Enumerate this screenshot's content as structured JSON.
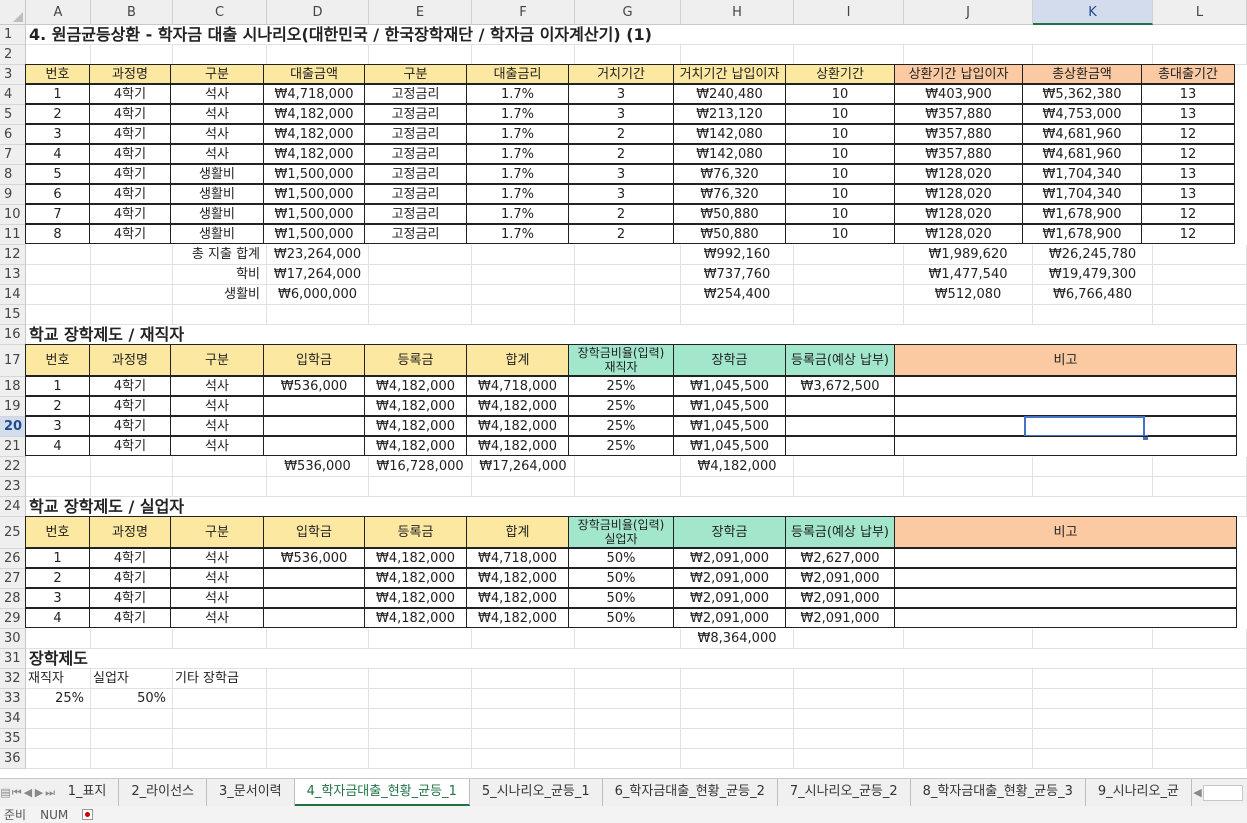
{
  "columns": [
    "A",
    "B",
    "C",
    "D",
    "E",
    "F",
    "G",
    "H",
    "I",
    "J",
    "K",
    "L"
  ],
  "selected_column": "K",
  "selected_row": "20",
  "rows": [
    "1",
    "2",
    "3",
    "4",
    "5",
    "6",
    "7",
    "8",
    "9",
    "10",
    "11",
    "12",
    "13",
    "14",
    "15",
    "16",
    "17",
    "18",
    "19",
    "20",
    "21",
    "22",
    "23",
    "24",
    "25",
    "26",
    "27",
    "28",
    "29",
    "30",
    "31",
    "32",
    "33",
    "34",
    "35",
    "36"
  ],
  "title": "4. 원금균등상환 - 학자금 대출 시나리오(대한민국 / 한국장학재단 / 학자금 이자계산기) (1)",
  "loan_table": {
    "headers": [
      "번호",
      "과정명",
      "구분",
      "대출금액",
      "구분",
      "대출금리",
      "거치기간",
      "거치기간 납입이자",
      "상환기간",
      "상환기간 납입이자",
      "총상환금액",
      "총대출기간"
    ],
    "rows": [
      [
        "1",
        "4학기",
        "석사",
        "₩4,718,000",
        "고정금리",
        "1.7%",
        "3",
        "₩240,480",
        "10",
        "₩403,900",
        "₩5,362,380",
        "13"
      ],
      [
        "2",
        "4학기",
        "석사",
        "₩4,182,000",
        "고정금리",
        "1.7%",
        "3",
        "₩213,120",
        "10",
        "₩357,880",
        "₩4,753,000",
        "13"
      ],
      [
        "3",
        "4학기",
        "석사",
        "₩4,182,000",
        "고정금리",
        "1.7%",
        "2",
        "₩142,080",
        "10",
        "₩357,880",
        "₩4,681,960",
        "12"
      ],
      [
        "4",
        "4학기",
        "석사",
        "₩4,182,000",
        "고정금리",
        "1.7%",
        "2",
        "₩142,080",
        "10",
        "₩357,880",
        "₩4,681,960",
        "12"
      ],
      [
        "5",
        "4학기",
        "생활비",
        "₩1,500,000",
        "고정금리",
        "1.7%",
        "3",
        "₩76,320",
        "10",
        "₩128,020",
        "₩1,704,340",
        "13"
      ],
      [
        "6",
        "4학기",
        "생활비",
        "₩1,500,000",
        "고정금리",
        "1.7%",
        "3",
        "₩76,320",
        "10",
        "₩128,020",
        "₩1,704,340",
        "13"
      ],
      [
        "7",
        "4학기",
        "생활비",
        "₩1,500,000",
        "고정금리",
        "1.7%",
        "2",
        "₩50,880",
        "10",
        "₩128,020",
        "₩1,678,900",
        "12"
      ],
      [
        "8",
        "4학기",
        "생활비",
        "₩1,500,000",
        "고정금리",
        "1.7%",
        "2",
        "₩50,880",
        "10",
        "₩128,020",
        "₩1,678,900",
        "12"
      ]
    ],
    "summary": [
      {
        "label": "총 지출 합계",
        "amount": "₩23,264,000",
        "h": "₩992,160",
        "j": "₩1,989,620",
        "k": "₩26,245,780"
      },
      {
        "label": "학비",
        "amount": "₩17,264,000",
        "h": "₩737,760",
        "j": "₩1,477,540",
        "k": "₩19,479,300"
      },
      {
        "label": "생활비",
        "amount": "₩6,000,000",
        "h": "₩254,400",
        "j": "₩512,080",
        "k": "₩6,766,480"
      }
    ]
  },
  "employed": {
    "title": "학교 장학제도 / 재직자",
    "headers": [
      "번호",
      "과정명",
      "구분",
      "입학금",
      "등록금",
      "합계",
      "장학금비율(입력)",
      "재직자",
      "장학금",
      "등록금(예상 납부)",
      "비고"
    ],
    "rows": [
      [
        "1",
        "4학기",
        "석사",
        "₩536,000",
        "₩4,182,000",
        "₩4,718,000",
        "25%",
        "₩1,045,500",
        "₩3,672,500",
        ""
      ],
      [
        "2",
        "4학기",
        "석사",
        "",
        "₩4,182,000",
        "₩4,182,000",
        "25%",
        "₩1,045,500",
        "",
        ""
      ],
      [
        "3",
        "4학기",
        "석사",
        "",
        "₩4,182,000",
        "₩4,182,000",
        "25%",
        "₩1,045,500",
        "",
        ""
      ],
      [
        "4",
        "4학기",
        "석사",
        "",
        "₩4,182,000",
        "₩4,182,000",
        "25%",
        "₩1,045,500",
        "",
        ""
      ]
    ],
    "totals": {
      "d": "₩536,000",
      "e": "₩16,728,000",
      "f": "₩17,264,000",
      "h": "₩4,182,000"
    }
  },
  "unemployed": {
    "title": "학교 장학제도 / 실업자",
    "headers": [
      "번호",
      "과정명",
      "구분",
      "입학금",
      "등록금",
      "합계",
      "장학금비율(입력)",
      "실업자",
      "장학금",
      "등록금(예상 납부)",
      "비고"
    ],
    "rows": [
      [
        "1",
        "4학기",
        "석사",
        "₩536,000",
        "₩4,182,000",
        "₩4,718,000",
        "50%",
        "₩2,091,000",
        "₩2,627,000",
        ""
      ],
      [
        "2",
        "4학기",
        "석사",
        "",
        "₩4,182,000",
        "₩4,182,000",
        "50%",
        "₩2,091,000",
        "₩2,091,000",
        ""
      ],
      [
        "3",
        "4학기",
        "석사",
        "",
        "₩4,182,000",
        "₩4,182,000",
        "50%",
        "₩2,091,000",
        "₩2,091,000",
        ""
      ],
      [
        "4",
        "4학기",
        "석사",
        "",
        "₩4,182,000",
        "₩4,182,000",
        "50%",
        "₩2,091,000",
        "₩2,091,000",
        ""
      ]
    ],
    "totals": {
      "h": "₩8,364,000"
    }
  },
  "scholarship": {
    "title": "장학제도",
    "labels": [
      "재직자",
      "실업자",
      "기타 장학금"
    ],
    "values": [
      "25%",
      "50%"
    ]
  },
  "tabs": [
    "1_표지",
    "2_라이선스",
    "3_문서이력",
    "4_학자금대출_현황_균등_1",
    "5_시나리오_균등_1",
    "6_학자금대출_현황_균등_2",
    "7_시나리오_균등_2",
    "8_학자금대출_현황_균등_3",
    "9_시나리오_균"
  ],
  "active_tab": "4_학자금대출_현황_균등_1",
  "status": {
    "mode": "준비",
    "numlock": "NUM"
  }
}
